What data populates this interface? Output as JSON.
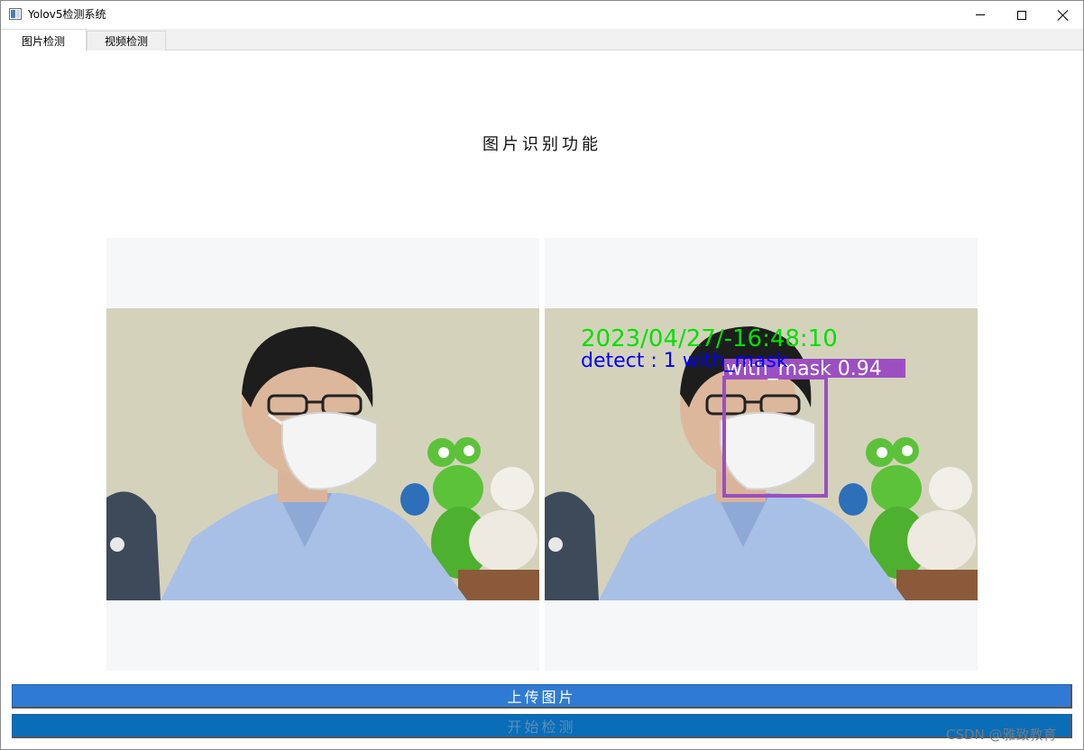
{
  "window": {
    "title": "Yolov5检测系统"
  },
  "tabs": [
    {
      "label": "图片检测",
      "active": true
    },
    {
      "label": "视频检测",
      "active": false
    }
  ],
  "main": {
    "heading": "图片识别功能",
    "result_overlay": {
      "timestamp": "2023/04/27/-16:48:10",
      "detect_summary": "detect : 1 with_mask",
      "box_label": "with_mask 0.94"
    }
  },
  "buttons": {
    "upload_label": "上传图片",
    "detect_label": "开始检测"
  },
  "watermark": "CSDN @雅致教育",
  "colors": {
    "upload_button": "#2f7bd4",
    "detect_button": "#0a6db8",
    "timestamp_text": "#00e000",
    "summary_text": "#0000ff",
    "detection_box": "#9b4fc0"
  }
}
